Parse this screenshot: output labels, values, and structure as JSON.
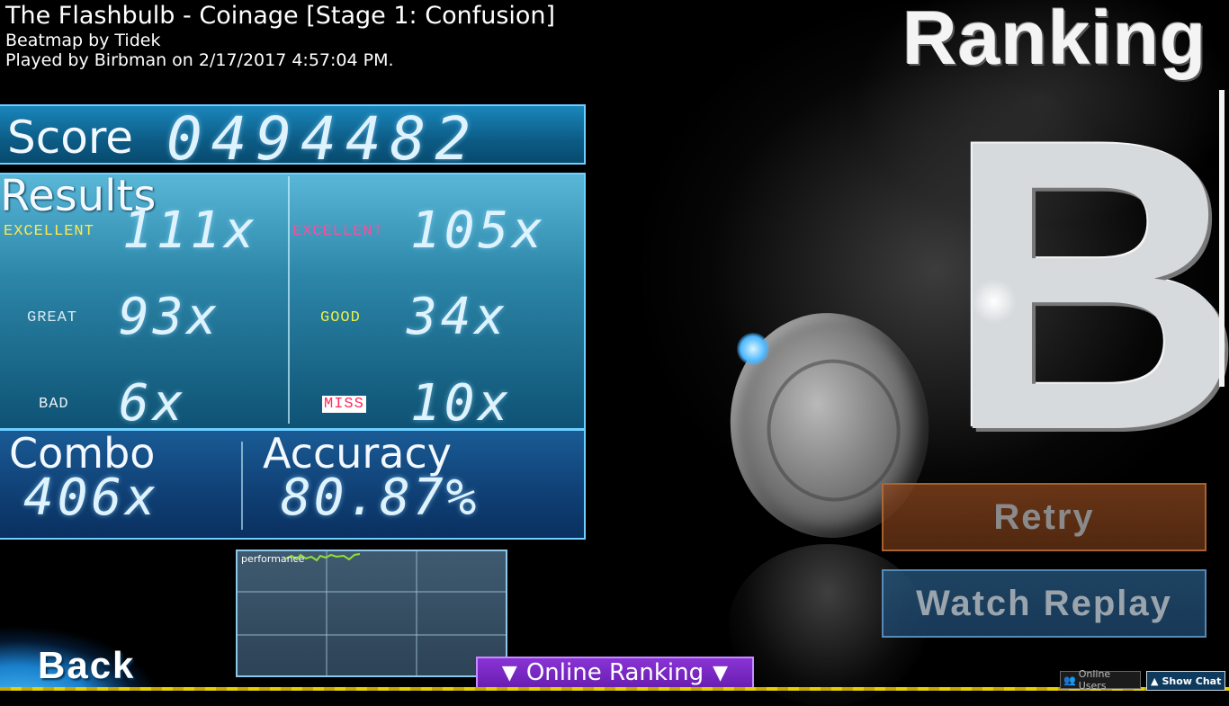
{
  "header": {
    "song_title": "The Flashbulb - Coinage [Stage 1: Confusion]",
    "beatmap_by": "Beatmap by Tidek",
    "played_by": "Played by Birbman on 2/17/2017 4:57:04 PM.",
    "ranking_title": "Ranking"
  },
  "score": {
    "label": "Score",
    "value": "0494482"
  },
  "results": {
    "label": "Results",
    "left": [
      {
        "label": "EXCELLENT",
        "value": "111x",
        "color": "#ffe94a"
      },
      {
        "label": "GREAT",
        "value": "93x",
        "color": "#d8e8f4"
      },
      {
        "label": "BAD",
        "value": "6x",
        "color": "#e8eef4"
      }
    ],
    "right": [
      {
        "label": "EXCELLENT",
        "value": "105x",
        "color": "#ff4c9c"
      },
      {
        "label": "GOOD",
        "value": "34x",
        "color": "#e6f04a"
      },
      {
        "label": "MISS",
        "value": "10x",
        "color": "#ff2a5c"
      }
    ]
  },
  "combo": {
    "label": "Combo",
    "value": "406x"
  },
  "accuracy": {
    "label": "Accuracy",
    "value": "80.87%"
  },
  "graph": {
    "label": "performance",
    "line_color": "#8fe03a"
  },
  "rank": {
    "letter": "B"
  },
  "buttons": {
    "retry": "Retry",
    "watch_replay": "Watch Replay",
    "back": "Back",
    "online_ranking": "Online Ranking",
    "online_users": "Online Users",
    "show_chat": "Show Chat"
  },
  "icons": {
    "online_ranking_arrow": "triangle-down-icon",
    "show_chat_arrow": "chevron-up-icon",
    "online_users": "users-icon"
  }
}
